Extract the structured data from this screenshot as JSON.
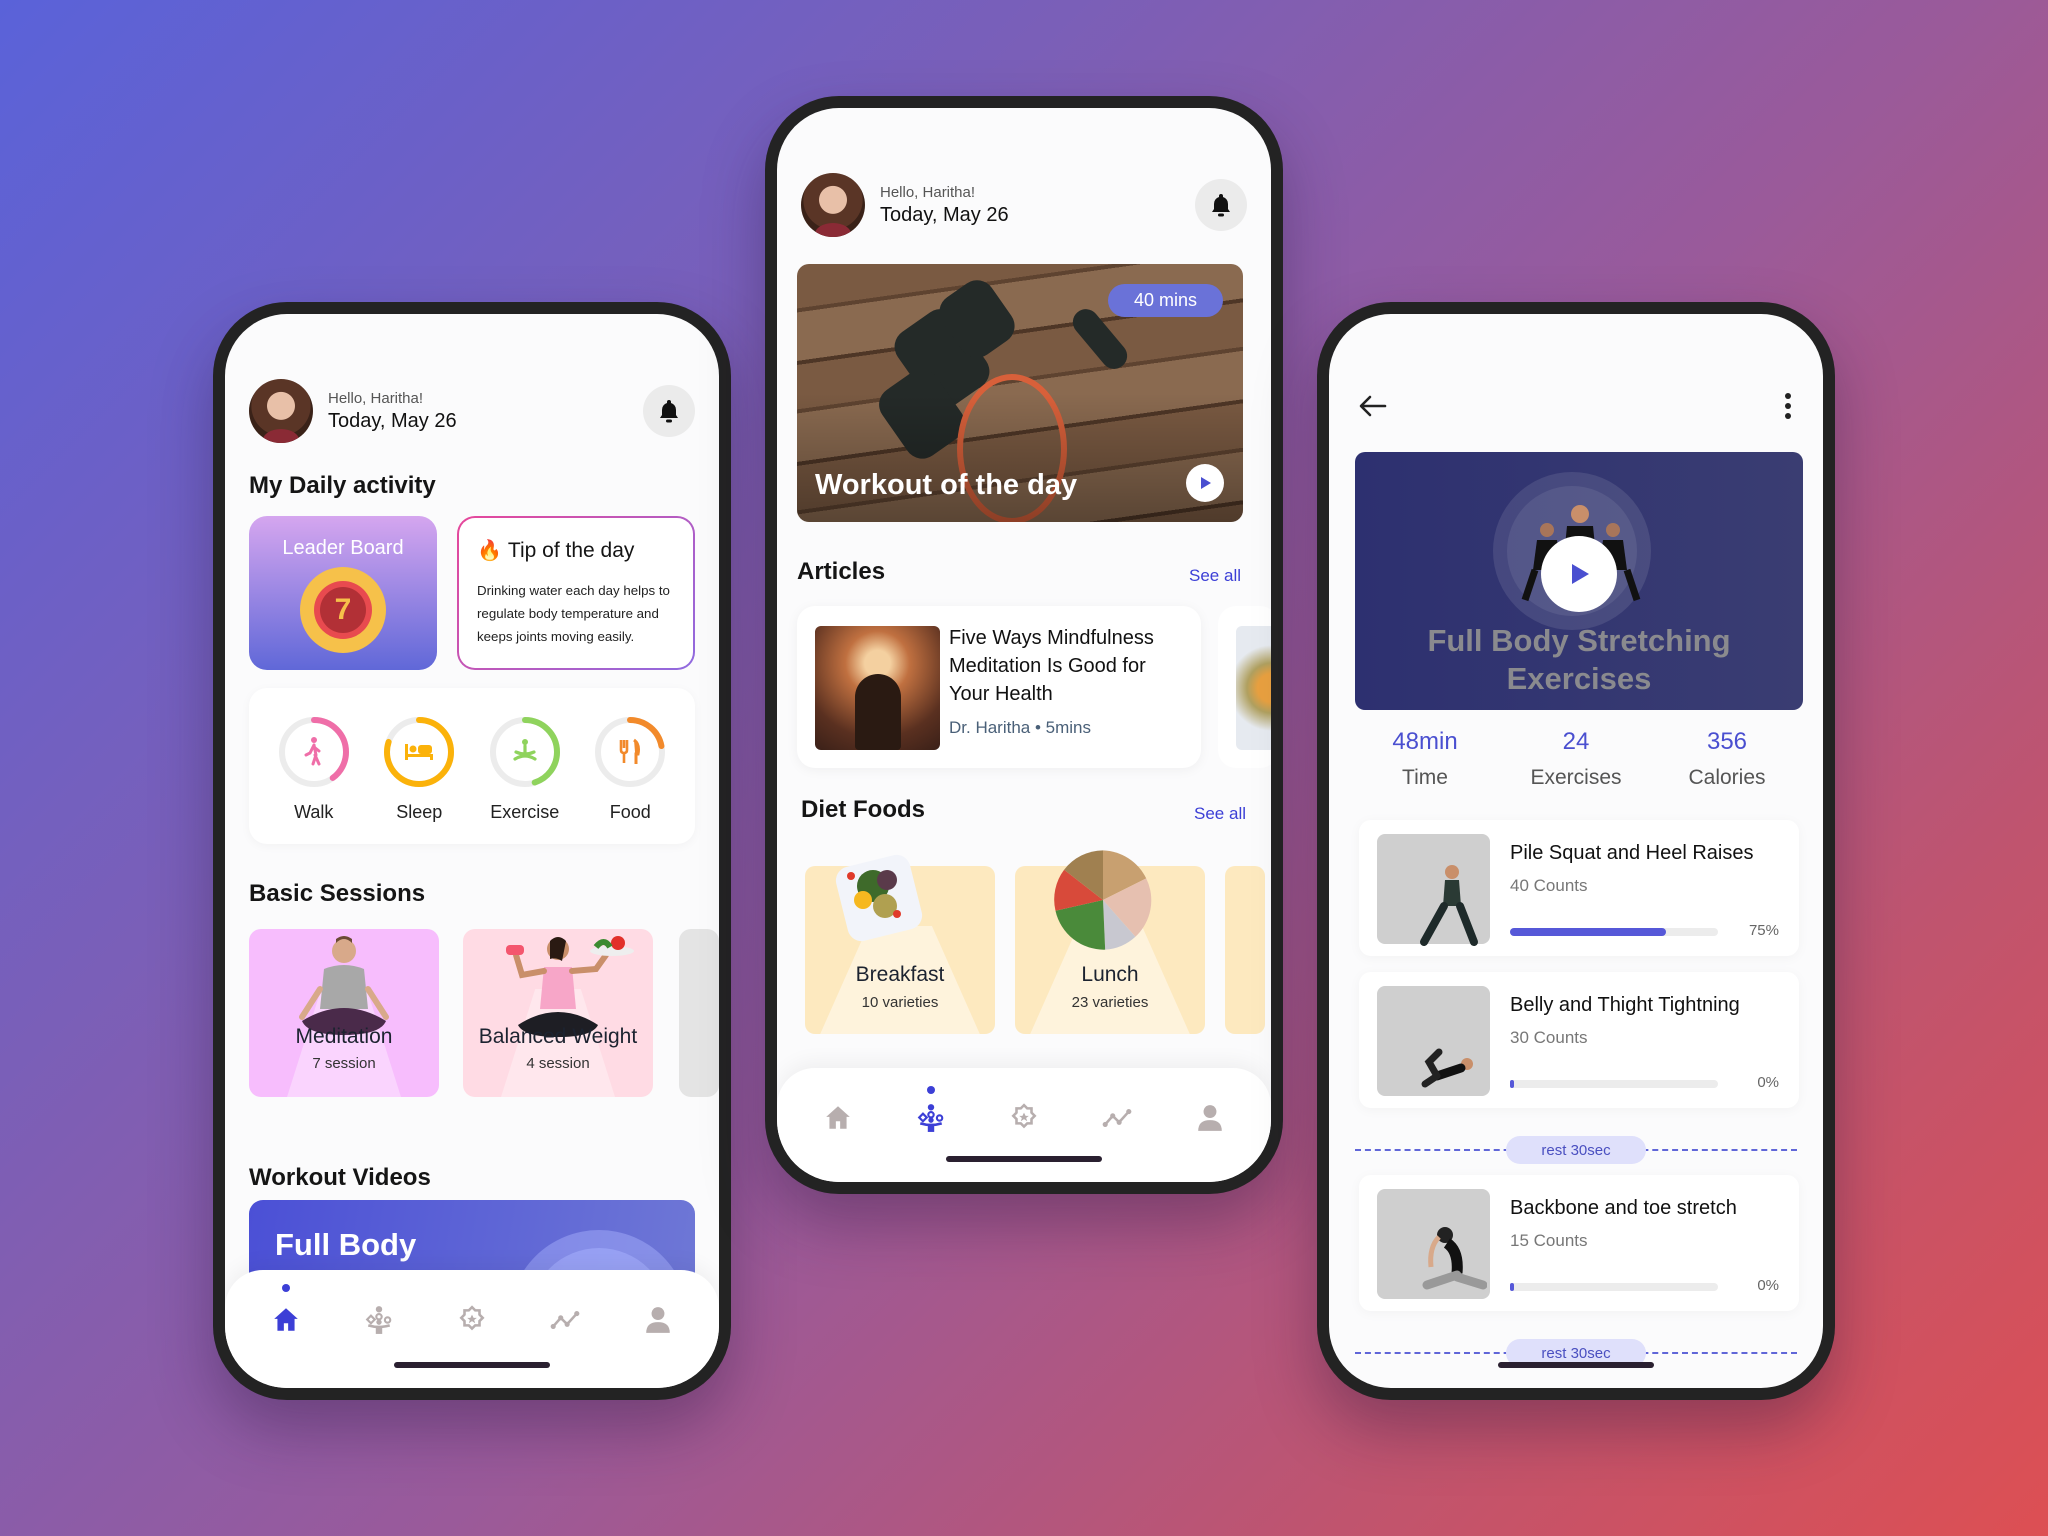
{
  "theme": {
    "accent": "#3c3fd6",
    "background_start": "#5a62d9",
    "background_end": "#dd4f53"
  },
  "user": {
    "greeting": "Hello, Haritha!",
    "date": "Today, May 26"
  },
  "home": {
    "daily_activity_title": "My Daily activity",
    "leaderboard": {
      "label": "Leader Board",
      "rank": "7"
    },
    "tip": {
      "title": "Tip of the day",
      "icon": "fire-icon",
      "body": "Drinking water each day helps to regulate body temperature and keeps joints moving easily."
    },
    "activities": [
      {
        "label": "Walk",
        "icon": "walk-icon",
        "progress": 0.4,
        "color": "#ef6ea8"
      },
      {
        "label": "Sleep",
        "icon": "bed-icon",
        "progress": 0.8,
        "color": "#fbb20a"
      },
      {
        "label": "Exercise",
        "icon": "meditation-icon",
        "progress": 0.45,
        "color": "#8fd35d"
      },
      {
        "label": "Food",
        "icon": "cutlery-icon",
        "progress": 0.22,
        "color": "#f28a2b"
      }
    ],
    "basic_sessions_title": "Basic Sessions",
    "sessions": [
      {
        "title": "Meditation",
        "count": "7 session",
        "color": "#f7bdfd"
      },
      {
        "title": "Balanced Weight",
        "count": "4 session",
        "color": "#ffdbe4"
      }
    ],
    "workout_videos_title": "Workout Videos",
    "workout_video": {
      "title": "Full Body Stretching"
    }
  },
  "explore": {
    "workout_of_day": {
      "title": "Workout of the day",
      "duration": "40 mins"
    },
    "articles_title": "Articles",
    "see_all": "See all",
    "articles": [
      {
        "title": "Five Ways Mindfulness Meditation Is Good for Your Health",
        "meta": "Dr. Haritha • 5mins"
      }
    ],
    "diet_title": "Diet Foods",
    "diet": [
      {
        "title": "Breakfast",
        "count": "10 varieties"
      },
      {
        "title": "Lunch",
        "count": "23 varieties"
      }
    ]
  },
  "detail": {
    "title": "Full Body Stretching Exercises",
    "stats": [
      {
        "value": "48min",
        "label": "Time"
      },
      {
        "value": "24",
        "label": "Exercises"
      },
      {
        "value": "356",
        "label": "Calories"
      }
    ],
    "exercises": [
      {
        "name": "Pile Squat and Heel Raises",
        "counts": "40 Counts",
        "progress": 0.75,
        "progress_label": "75%"
      },
      {
        "name": "Belly and Thight Tightning",
        "counts": "30 Counts",
        "progress": 0,
        "progress_label": "0%"
      },
      {
        "name": "Backbone and toe stretch",
        "counts": "15 Counts",
        "progress": 0,
        "progress_label": "0%"
      }
    ],
    "rest_label": "rest 30sec"
  },
  "nav": {
    "items": [
      {
        "name": "home",
        "icon": "home-icon"
      },
      {
        "name": "explore",
        "icon": "juggler-icon"
      },
      {
        "name": "badges",
        "icon": "badge-star-icon"
      },
      {
        "name": "progress",
        "icon": "chart-line-icon"
      },
      {
        "name": "profile",
        "icon": "person-icon"
      }
    ]
  }
}
